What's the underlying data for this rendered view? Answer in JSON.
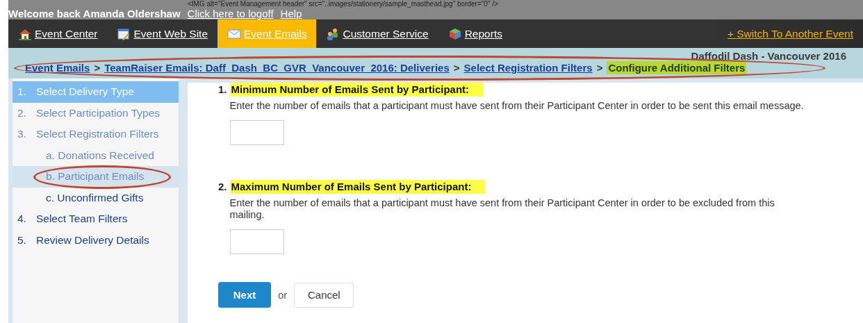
{
  "header": {
    "source_text": "<IMG alt=\"Event Management header\" src=\"..images/stationery/sample_masthead.jpg\" border=\"0\" />",
    "welcome": "Welcome back Amanda Oldershaw",
    "links": [
      "Click here to logoff",
      "Help"
    ]
  },
  "nav": {
    "items": [
      {
        "label": "Event Center",
        "kind": "house",
        "selected": false
      },
      {
        "label": "Event Web Site",
        "kind": "page",
        "selected": false
      },
      {
        "label": "Event Emails",
        "kind": "envelope",
        "selected": true
      },
      {
        "label": "Customer Service",
        "kind": "people",
        "selected": false
      },
      {
        "label": "Reports",
        "kind": "chart",
        "selected": false
      }
    ],
    "switch_link": "+ Switch To Another Event"
  },
  "event_name": "Daffodil Dash - Vancouver 2016",
  "breadcrumb": {
    "links": [
      "Event Emails",
      "TeamRaiser Emails: Daff_Dash_BC_GVR_Vancouver_2016: Deliveries",
      "Select Registration Filters"
    ],
    "separator": ">",
    "current": "Configure Additional Filters",
    "circled": true
  },
  "steps": [
    {
      "number": "1.",
      "label": "Select Delivery Type",
      "selected": true,
      "visited": true
    },
    {
      "number": "2.",
      "label": "Select Participation Types",
      "selected": false,
      "visited": true
    },
    {
      "number": "3.",
      "label": "Select Registration Filters",
      "selected": false,
      "visited": true,
      "children": [
        {
          "label": "a. Donations Received",
          "selected": false,
          "visited": true,
          "circled": false
        },
        {
          "label": "b. Participant Emails",
          "selected": true,
          "visited": true,
          "circled": true
        },
        {
          "label": "c. Unconfirmed Gifts",
          "selected": false,
          "visited": false,
          "circled": false
        }
      ]
    },
    {
      "number": "4.",
      "label": "Select Team Filters",
      "selected": false,
      "visited": false
    },
    {
      "number": "5.",
      "label": "Review Delivery Details",
      "selected": false,
      "visited": false
    }
  ],
  "form": {
    "fields": [
      {
        "number": "1.",
        "label": "Minimum Number of Emails Sent by Participant:",
        "help": "Enter the number of emails that a participant must have sent from their Participant Center in order to be sent this email message."
      },
      {
        "number": "2.",
        "label": "Maximum Number of Emails Sent by Participant:",
        "help": "Enter the number of emails that a participant must have sent from their Participant Center in order to be excluded from this mailing."
      }
    ],
    "next_button": "Next",
    "or_text": "or",
    "cancel_button": "Cancel"
  }
}
